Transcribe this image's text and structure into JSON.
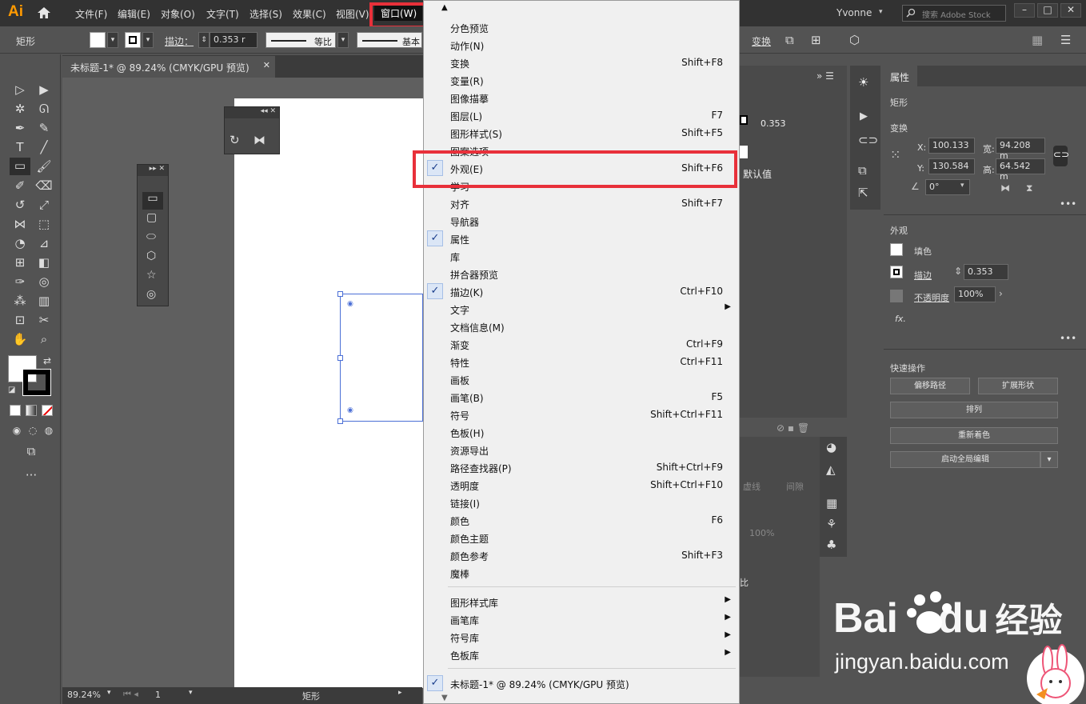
{
  "app": {
    "logo": "Ai",
    "user": "Yvonne",
    "search_placeholder": "搜索 Adobe Stock"
  },
  "menubar": {
    "items": [
      "文件(F)",
      "编辑(E)",
      "对象(O)",
      "文字(T)",
      "选择(S)",
      "效果(C)",
      "视图(V)"
    ],
    "window_menu": "窗口(W)"
  },
  "control": {
    "tool_name": "矩形",
    "stroke_label": "描边：",
    "stroke_value": "0.353 r",
    "line_style": "等比",
    "line_profile": "基本",
    "transform_label": "变换"
  },
  "document": {
    "tab_title": "未标题-1* @ 89.24% (CMYK/GPU 预览)",
    "zoom": "89.24%",
    "page": "1",
    "status": "矩形"
  },
  "window_menu_items": [
    {
      "label": "分色预览",
      "shortcut": "",
      "checked": false,
      "submenu": false
    },
    {
      "label": "动作(N)",
      "shortcut": "",
      "checked": false,
      "submenu": false
    },
    {
      "label": "变换",
      "shortcut": "Shift+F8",
      "checked": false,
      "submenu": false
    },
    {
      "label": "变量(R)",
      "shortcut": "",
      "checked": false,
      "submenu": false
    },
    {
      "label": "图像描摹",
      "shortcut": "",
      "checked": false,
      "submenu": false
    },
    {
      "label": "图层(L)",
      "shortcut": "F7",
      "checked": false,
      "submenu": false
    },
    {
      "label": "图形样式(S)",
      "shortcut": "Shift+F5",
      "checked": false,
      "submenu": false
    },
    {
      "label": "图案选项",
      "shortcut": "",
      "checked": false,
      "submenu": false
    },
    {
      "label": "外观(E)",
      "shortcut": "Shift+F6",
      "checked": true,
      "submenu": false
    },
    {
      "label": "学习",
      "shortcut": "",
      "checked": false,
      "submenu": false
    },
    {
      "label": "对齐",
      "shortcut": "Shift+F7",
      "checked": false,
      "submenu": false
    },
    {
      "label": "导航器",
      "shortcut": "",
      "checked": false,
      "submenu": false
    },
    {
      "label": "属性",
      "shortcut": "",
      "checked": true,
      "submenu": false
    },
    {
      "label": "库",
      "shortcut": "",
      "checked": false,
      "submenu": false
    },
    {
      "label": "拼合器预览",
      "shortcut": "",
      "checked": false,
      "submenu": false
    },
    {
      "label": "描边(K)",
      "shortcut": "Ctrl+F10",
      "checked": true,
      "submenu": false
    },
    {
      "label": "文字",
      "shortcut": "",
      "checked": false,
      "submenu": true
    },
    {
      "label": "文档信息(M)",
      "shortcut": "",
      "checked": false,
      "submenu": false
    },
    {
      "label": "渐变",
      "shortcut": "Ctrl+F9",
      "checked": false,
      "submenu": false
    },
    {
      "label": "特性",
      "shortcut": "Ctrl+F11",
      "checked": false,
      "submenu": false
    },
    {
      "label": "画板",
      "shortcut": "",
      "checked": false,
      "submenu": false
    },
    {
      "label": "画笔(B)",
      "shortcut": "F5",
      "checked": false,
      "submenu": false
    },
    {
      "label": "符号",
      "shortcut": "Shift+Ctrl+F11",
      "checked": false,
      "submenu": false
    },
    {
      "label": "色板(H)",
      "shortcut": "",
      "checked": false,
      "submenu": false
    },
    {
      "label": "资源导出",
      "shortcut": "",
      "checked": false,
      "submenu": false
    },
    {
      "label": "路径查找器(P)",
      "shortcut": "Shift+Ctrl+F9",
      "checked": false,
      "submenu": false
    },
    {
      "label": "透明度",
      "shortcut": "Shift+Ctrl+F10",
      "checked": false,
      "submenu": false
    },
    {
      "label": "链接(I)",
      "shortcut": "",
      "checked": false,
      "submenu": false
    },
    {
      "label": "颜色",
      "shortcut": "F6",
      "checked": false,
      "submenu": false
    },
    {
      "label": "颜色主题",
      "shortcut": "",
      "checked": false,
      "submenu": false
    },
    {
      "label": "颜色参考",
      "shortcut": "Shift+F3",
      "checked": false,
      "submenu": false
    },
    {
      "label": "魔棒",
      "shortcut": "",
      "checked": false,
      "submenu": false
    }
  ],
  "window_menu_libraries": [
    {
      "label": "图形样式库",
      "submenu": true
    },
    {
      "label": "画笔库",
      "submenu": true
    },
    {
      "label": "符号库",
      "submenu": true
    },
    {
      "label": "色板库",
      "submenu": true
    }
  ],
  "window_menu_documents": [
    {
      "label": "未标题-1* @ 89.24% (CMYK/GPU 预览)",
      "checked": true
    }
  ],
  "hidden_panel": {
    "stroke_value": "0.353",
    "default_label": "默认值",
    "ratio_label": "比",
    "opacity": "100%",
    "dashed": "虚线",
    "gap": "间隙"
  },
  "properties": {
    "tab": "属性",
    "object": "矩形",
    "transform_title": "变换",
    "x_label": "X:",
    "x": "100.133",
    "y_label": "Y:",
    "y": "130.584",
    "w_label": "宽:",
    "w": "94.208 m",
    "h_label": "高:",
    "h": "64.542 m",
    "angle": "0°",
    "appearance_title": "外观",
    "fill_label": "填色",
    "stroke_label": "描边",
    "stroke_value": "0.353",
    "opacity_label": "不透明度",
    "opacity": "100%",
    "fx": "fx.",
    "quick_title": "快速操作",
    "btn_offset": "偏移路径",
    "btn_expand": "扩展形状",
    "btn_arrange": "排列",
    "btn_recolor": "重新着色",
    "btn_global": "启动全局编辑"
  },
  "watermark": {
    "brand_left": "Bai",
    "brand_mid": "du",
    "brand_cn": "经验",
    "url": "jingyan.baidu.com"
  },
  "colors": {
    "highlight": "#e8303a",
    "menu_bg": "#f0f0f0",
    "ui_dark": "#323232",
    "ui_mid": "#535353",
    "selection": "#4b6fd6"
  }
}
